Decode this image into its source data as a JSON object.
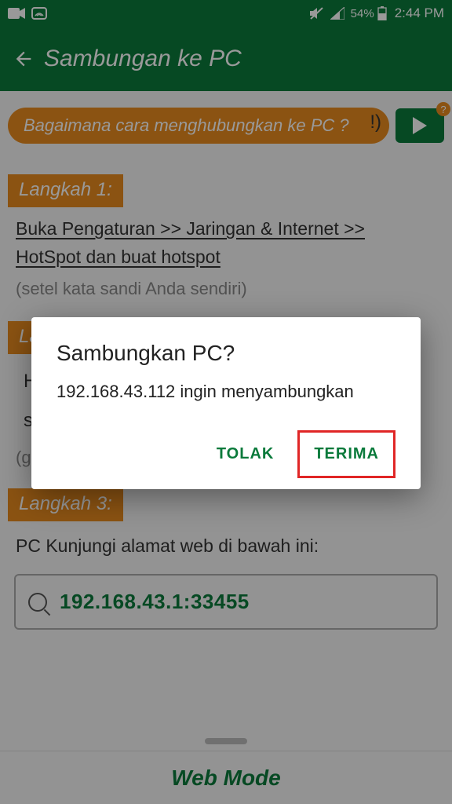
{
  "status": {
    "battery_pct": "54%",
    "time": "2:44 PM"
  },
  "header": {
    "title": "Sambungan ke PC"
  },
  "banner": {
    "text": "Bagaimana cara menghubungkan ke PC ?",
    "behind_fragment": "!)"
  },
  "steps": {
    "s1": {
      "label": "Langkah 1:",
      "line1": "Buka  Pengaturan  >> Jaringan & Internet  >>",
      "line2": "HotSpot  dan buat hotspot",
      "note": "(setel kata sandi Anda sendiri)"
    },
    "s2": {
      "label_partial": "La",
      "line_a": "H",
      "line_b": "s",
      "note_partial": "(g"
    },
    "s3": {
      "label": "Langkah 3:",
      "body": "PC Kunjungi alamat web di bawah ini:"
    }
  },
  "address": "192.168.43.1:33455",
  "footer": "Web Mode",
  "dialog": {
    "title": "Sambungkan PC?",
    "body": "192.168.43.112 ingin menyambungkan",
    "reject": "TOLAK",
    "accept": "TERIMA"
  }
}
